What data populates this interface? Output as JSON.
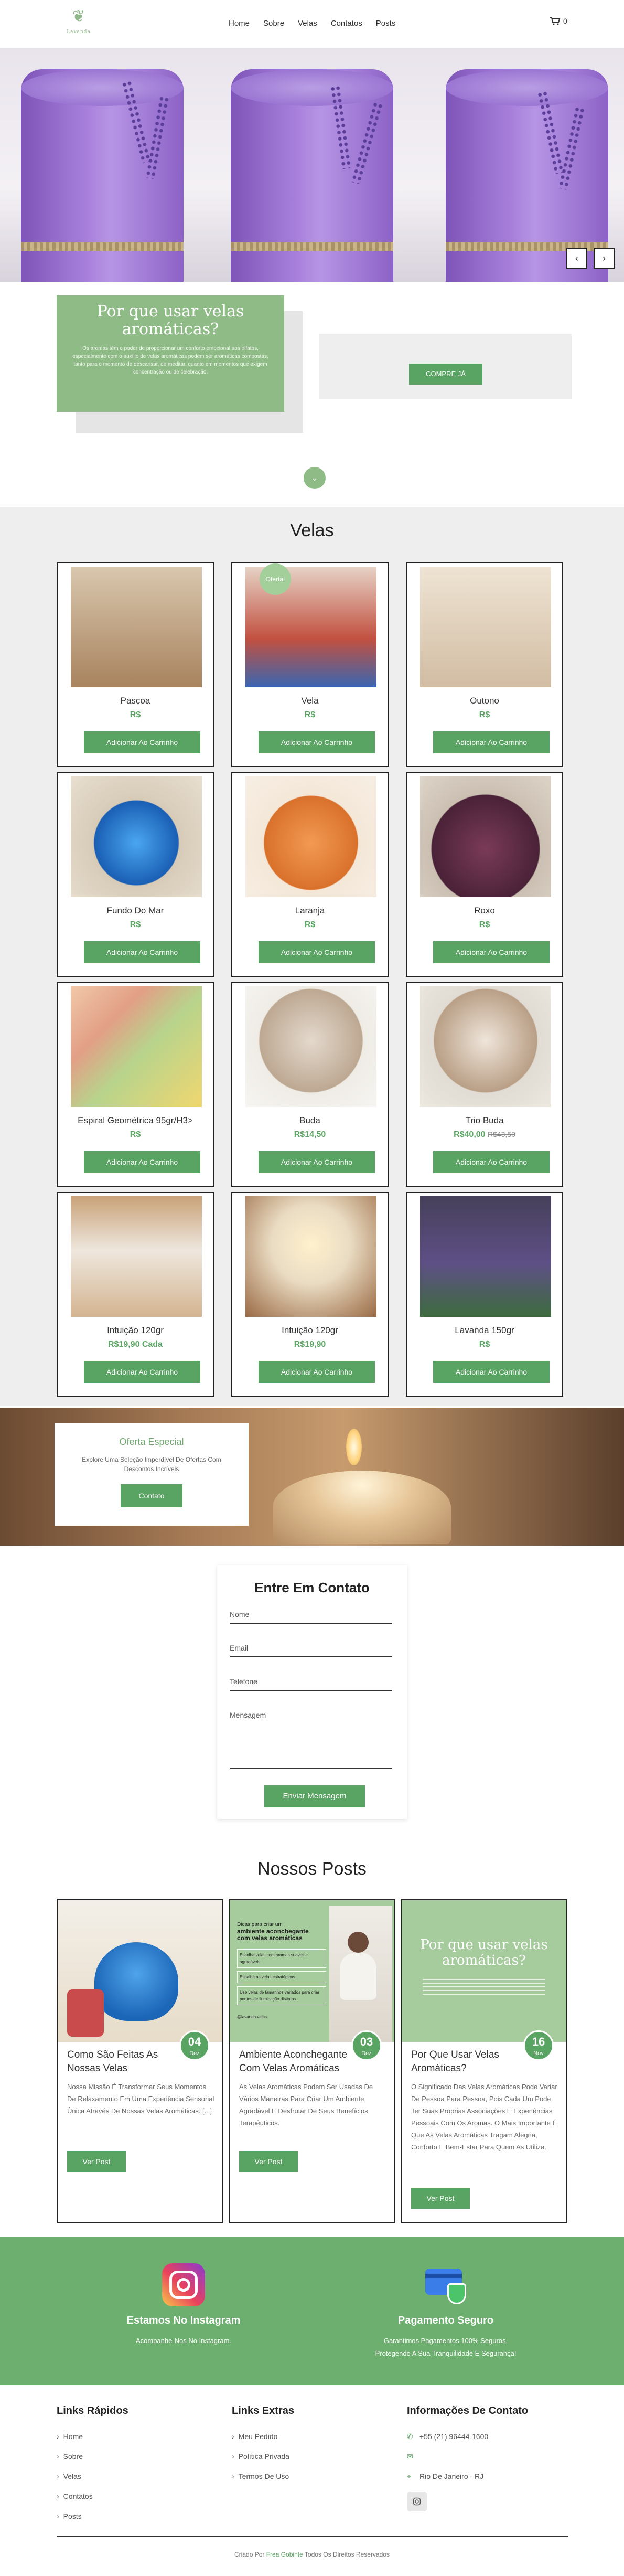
{
  "header": {
    "brand": "Lavanda",
    "nav": [
      "Home",
      "Sobre",
      "Velas",
      "Contatos",
      "Posts"
    ],
    "cart_count": "0"
  },
  "hero": {
    "prev_icon": "chevron-left-icon",
    "next_icon": "chevron-right-icon",
    "prev": "‹",
    "next": "›"
  },
  "intro": {
    "title": "Por que usar velas aromáticas?",
    "text": "Os aromas têm o poder de proporcionar um conforto emocional aos olfatos, especialmente com o auxílio de velas aromáticas podem ser aromáticas compostas, tanto para o momento de descansar, de meditar, quanto em momentos que exigem concentração ou de celebração.",
    "cta": "COMPRE JÁ"
  },
  "products": {
    "title": "Velas",
    "add_label": "Adicionar Ao Carrinho",
    "sale_badge": "Oferta!",
    "items": [
      {
        "name": "Pascoa",
        "price": "R$",
        "old": ""
      },
      {
        "name": "Vela",
        "price": "R$",
        "old": ""
      },
      {
        "name": "Outono",
        "price": "R$",
        "old": ""
      },
      {
        "name": "Fundo Do Mar",
        "price": "R$",
        "old": ""
      },
      {
        "name": "Laranja",
        "price": "R$",
        "old": ""
      },
      {
        "name": "Roxo",
        "price": "R$",
        "old": ""
      },
      {
        "name": "Espiral Geométrica 95gr/H3>",
        "price": "R$",
        "old": ""
      },
      {
        "name": "Buda",
        "price": "R$14,50",
        "old": ""
      },
      {
        "name": "Trio Buda",
        "price": "R$40,00",
        "old": "R$43,50"
      },
      {
        "name": "Intuição 120gr",
        "price": "R$19,90 Cada",
        "old": ""
      },
      {
        "name": "Intuição 120gr",
        "price": "R$19,90",
        "old": ""
      },
      {
        "name": "Lavanda 150gr",
        "price": "R$",
        "old": ""
      }
    ]
  },
  "offer": {
    "title": "Oferta Especial",
    "text": "Explore Uma Seleção Imperdível De Ofertas Com Descontos Incríveis",
    "button": "Contato"
  },
  "contact": {
    "title": "Entre Em Contato",
    "name": "Nome",
    "email": "Email",
    "phone": "Telefone",
    "message": "Mensagem",
    "send": "Enviar Mensagem"
  },
  "posts": {
    "title": "Nossos Posts",
    "more": "Ver Post",
    "items": [
      {
        "day": "04",
        "month": "Dez",
        "title": "Como São Feitas As Nossas Velas",
        "excerpt": "Nossa Missão É Transformar Seus Momentos De Relaxamento Em Uma Experiência Sensorial Única Através De Nossas Velas Aromáticas. [...]"
      },
      {
        "day": "03",
        "month": "Dez",
        "title": "Ambiente Aconchegante Com Velas Aromáticas",
        "excerpt": "As Velas Aromáticas Podem Ser Usadas De Vários Maneiras Para Criar Um Ambiente Agradável E Desfrutar De Seus Benefícios Terapêuticos."
      },
      {
        "day": "16",
        "month": "Nov",
        "title": "Por Que Usar Velas Aromáticas?",
        "excerpt": "O Significado Das Velas Aromáticas Pode Variar De Pessoa Para Pessoa, Pois Cada Um Pode Ter Suas Próprias Associações E Experiências Pessoais Com Os Aromas. O Mais Importante É Que As Velas Aromáticas Tragam Alegria, Conforto E Bem-Estar Para Quem As Utiliza."
      }
    ],
    "post2_image": {
      "line1": "Dicas para criar um",
      "line2": "ambiente aconchegante",
      "line3": "com velas aromáticas",
      "tip1": "Escolha velas com aromas suaves e agradáveis.",
      "tip2": "Espalhe as velas estratégicas.",
      "tip3": "Use velas de tamanhos variados para criar pontos de iluminação distintos.",
      "handle": "@lavanda.velas"
    },
    "post3_image": {
      "title": "Por que usar velas aromáticas?"
    }
  },
  "features": [
    {
      "title": "Estamos No Instagram",
      "text": "Acompanhe-Nos No Instagram.",
      "icon": "instagram-icon"
    },
    {
      "title": "Pagamento Seguro",
      "text": "Garantimos Pagamentos 100% Seguros, Protegendo A Sua Tranquilidade E Segurança!",
      "icon": "secure-payment-icon"
    }
  ],
  "footer": {
    "quick_title": "Links Rápidos",
    "quick": [
      "Home",
      "Sobre",
      "Velas",
      "Contatos",
      "Posts"
    ],
    "extra_title": "Links Extras",
    "extra": [
      "Meu Pedido",
      "Política Privada",
      "Termos De Uso"
    ],
    "info_title": "Informações De Contato",
    "phone": "+55 (21) 96444-1600",
    "email": "",
    "location": "Rio De Janeiro - RJ",
    "copyright_pre": "Criado Por",
    "copyright_name": "Frea Gobinte",
    "copyright_post": "Todos Os Direitos Reservados"
  },
  "colors": {
    "accent": "#5aa463",
    "soft_green": "#8fbb86",
    "lavender": "#9b76d3"
  }
}
